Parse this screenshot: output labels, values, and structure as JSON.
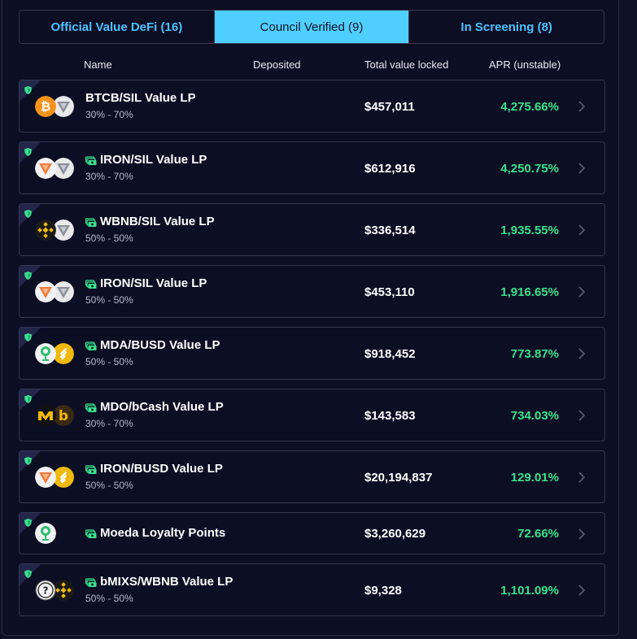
{
  "tabs": [
    {
      "label": "Official Value DeFi (16)",
      "active": false
    },
    {
      "label": "Council Verified (9)",
      "active": true
    },
    {
      "label": "In Screening (8)",
      "active": false
    }
  ],
  "columns": {
    "name": "Name",
    "deposited": "Deposited",
    "tvl": "Total value locked",
    "apr": "APR (unstable)"
  },
  "colors": {
    "accent": "#4fcfff",
    "apr_green": "#39e38b",
    "shield_green": "#3ee08f"
  },
  "pools": [
    {
      "name": "BTCB/SIL Value LP",
      "ratio": "30% - 70%",
      "tvl": "$457,011",
      "apr": "4,275.66%",
      "tokens": [
        "btcb-icon",
        "sil-icon"
      ],
      "money_icon": false
    },
    {
      "name": "IRON/SIL Value LP",
      "ratio": "30% - 70%",
      "tvl": "$612,916",
      "apr": "4,250.75%",
      "tokens": [
        "iron-icon",
        "sil-icon"
      ],
      "money_icon": true
    },
    {
      "name": "WBNB/SIL Value LP",
      "ratio": "50% - 50%",
      "tvl": "$336,514",
      "apr": "1,935.55%",
      "tokens": [
        "wbnb-icon",
        "sil-icon"
      ],
      "money_icon": true
    },
    {
      "name": "IRON/SIL Value LP",
      "ratio": "50% - 50%",
      "tvl": "$453,110",
      "apr": "1,916.65%",
      "tokens": [
        "iron-icon",
        "sil-icon"
      ],
      "money_icon": true
    },
    {
      "name": "MDA/BUSD Value LP",
      "ratio": "50% - 50%",
      "tvl": "$918,452",
      "apr": "773.87%",
      "tokens": [
        "mda-icon",
        "busd-icon"
      ],
      "money_icon": true
    },
    {
      "name": "MDO/bCash Value LP",
      "ratio": "30% - 70%",
      "tvl": "$143,583",
      "apr": "734.03%",
      "tokens": [
        "mdo-icon",
        "bcash-icon"
      ],
      "money_icon": true
    },
    {
      "name": "IRON/BUSD Value LP",
      "ratio": "50% - 50%",
      "tvl": "$20,194,837",
      "apr": "129.01%",
      "tokens": [
        "iron-icon",
        "busd-icon"
      ],
      "money_icon": true
    },
    {
      "name": "Moeda Loyalty Points",
      "ratio": "",
      "tvl": "$3,260,629",
      "apr": "72.66%",
      "tokens": [
        "mda-icon"
      ],
      "money_icon": true
    },
    {
      "name": "bMIXS/WBNB Value LP",
      "ratio": "50% - 50%",
      "tvl": "$9,328",
      "apr": "1,101.09%",
      "tokens": [
        "unknown-token-icon",
        "wbnb-icon"
      ],
      "money_icon": true
    }
  ]
}
